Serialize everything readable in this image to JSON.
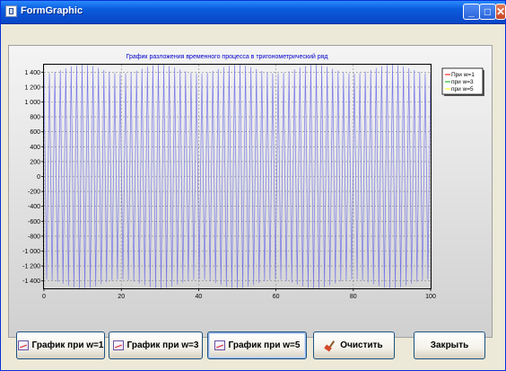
{
  "window": {
    "title": "FormGraphic",
    "icon": "form-icon",
    "controls": {
      "minimize": "_",
      "maximize": "□",
      "close": "✕"
    }
  },
  "chart": {
    "title": "График разложения временного процесса в тригонометрический ряд",
    "y_ticks": [
      "1 400",
      "1 200",
      "1 000",
      "800",
      "600",
      "400",
      "200",
      "0",
      "-200",
      "-400",
      "-600",
      "-800",
      "-1 000",
      "-1 200",
      "-1 400"
    ],
    "x_ticks": [
      "0",
      "20",
      "40",
      "60",
      "80",
      "100"
    ],
    "legend": [
      "При w=1",
      "при w=3",
      "при w=5"
    ],
    "colors": {
      "series": "#6B6BE8",
      "w1": "#FF0000",
      "w3": "#00AA00",
      "w5": "#FFFF00"
    }
  },
  "chart_data": {
    "type": "line",
    "title": "График разложения временного процесса в тригонометрический ряд",
    "xlabel": "",
    "ylabel": "",
    "xlim": [
      0,
      100
    ],
    "ylim": [
      -1500,
      1500
    ],
    "grid": true,
    "legend_position": "right",
    "series": [
      {
        "name": "При w=1",
        "amplitude": 1500,
        "oscillations": 71
      },
      {
        "name": "при w=3",
        "amplitude": 0,
        "oscillations": 0
      },
      {
        "name": "при w=5",
        "amplitude": 0,
        "oscillations": 0
      }
    ]
  },
  "buttons": {
    "w1": "График при w=1",
    "w3": "График при w=3",
    "w5": "График при w=5",
    "clear": "Очистить",
    "close": "Закрыть"
  }
}
